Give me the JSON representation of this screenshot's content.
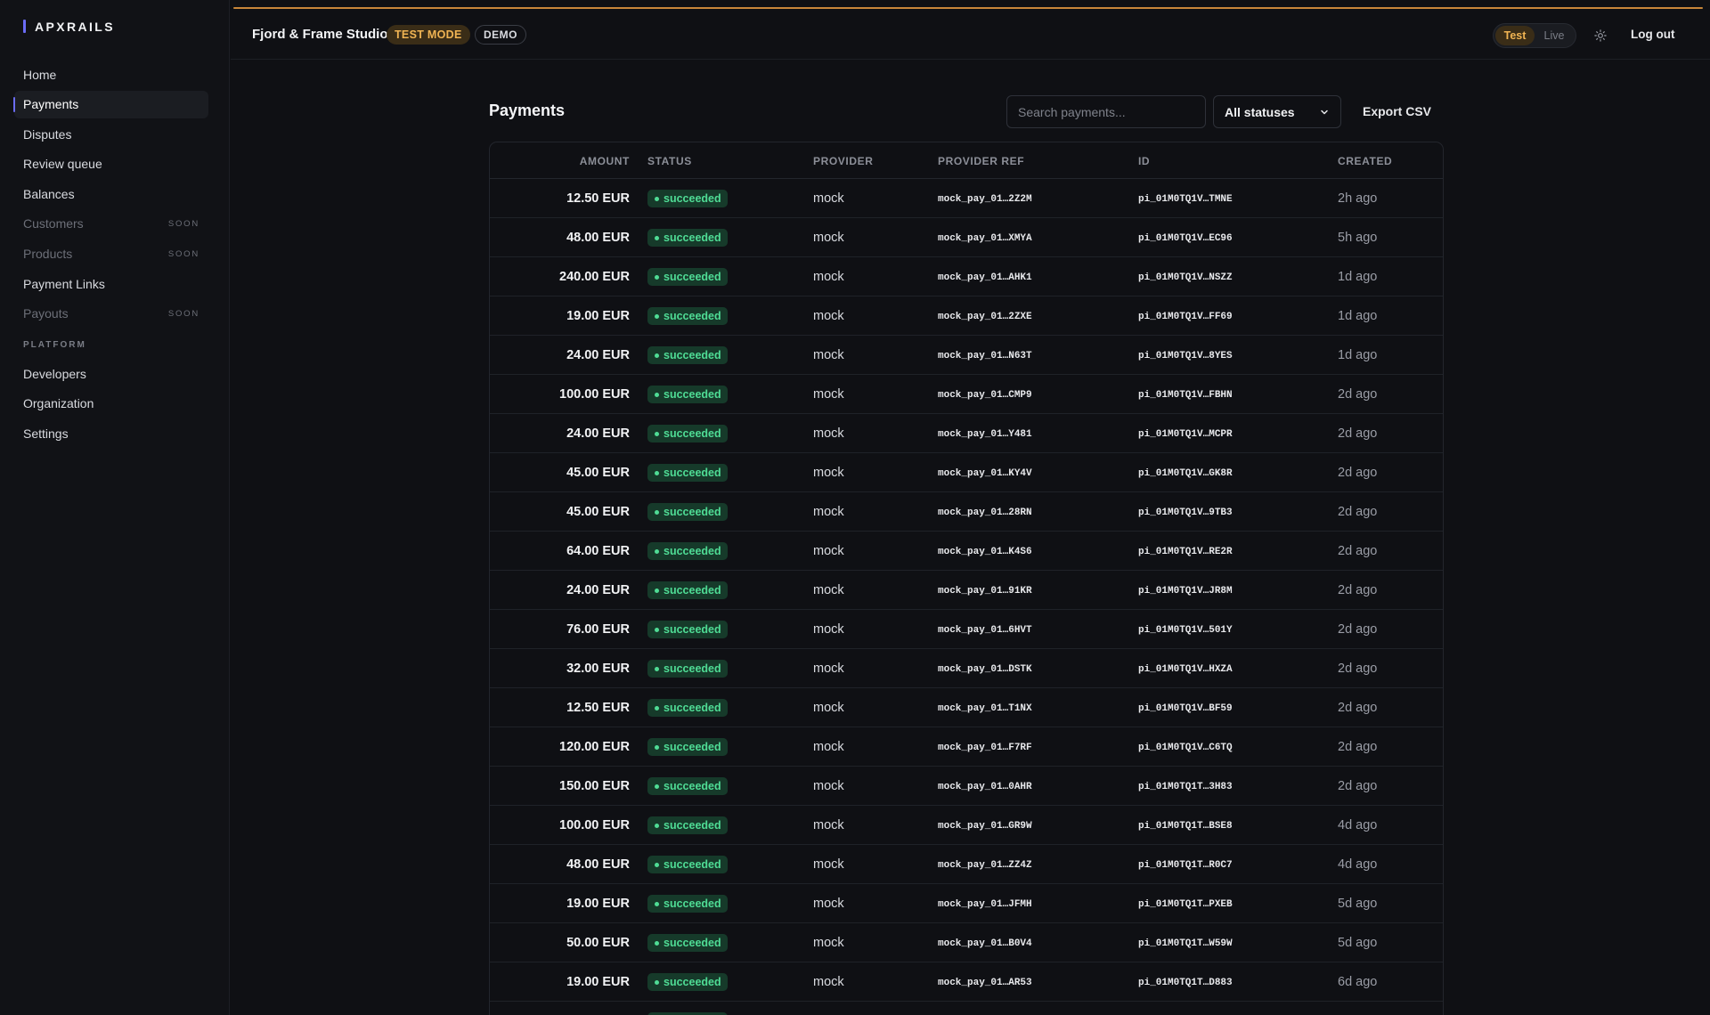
{
  "brand": "APXRAILS",
  "sidebar": {
    "items": [
      {
        "label": "Home",
        "soon": ""
      },
      {
        "label": "Payments",
        "soon": ""
      },
      {
        "label": "Disputes",
        "soon": ""
      },
      {
        "label": "Review queue",
        "soon": ""
      },
      {
        "label": "Balances",
        "soon": ""
      },
      {
        "label": "Customers",
        "soon": "SOON"
      },
      {
        "label": "Products",
        "soon": "SOON"
      },
      {
        "label": "Payment Links",
        "soon": ""
      },
      {
        "label": "Payouts",
        "soon": "SOON"
      }
    ],
    "section_label": "PLATFORM",
    "platform_items": [
      {
        "label": "Developers"
      },
      {
        "label": "Organization"
      },
      {
        "label": "Settings"
      }
    ]
  },
  "header": {
    "org_name": "Fjord & Frame Studio",
    "test_mode_badge": "TEST MODE",
    "demo_badge": "DEMO",
    "mode_test": "Test",
    "mode_live": "Live",
    "logout": "Log out"
  },
  "main": {
    "title": "Payments",
    "search_placeholder": "Search payments...",
    "status_filter": "All statuses",
    "export_label": "Export CSV",
    "columns": {
      "amount": "AMOUNT",
      "status": "STATUS",
      "provider": "PROVIDER",
      "provider_ref": "PROVIDER REF",
      "id": "ID",
      "created": "CREATED"
    },
    "rows": [
      {
        "amount": "12.50 EUR",
        "status": "succeeded",
        "provider": "mock",
        "ref": "mock_pay_01…2Z2M",
        "id": "pi_01M0TQ1V…TMNE",
        "created": "2h ago"
      },
      {
        "amount": "48.00 EUR",
        "status": "succeeded",
        "provider": "mock",
        "ref": "mock_pay_01…XMYA",
        "id": "pi_01M0TQ1V…EC96",
        "created": "5h ago"
      },
      {
        "amount": "240.00 EUR",
        "status": "succeeded",
        "provider": "mock",
        "ref": "mock_pay_01…AHK1",
        "id": "pi_01M0TQ1V…NSZZ",
        "created": "1d ago"
      },
      {
        "amount": "19.00 EUR",
        "status": "succeeded",
        "provider": "mock",
        "ref": "mock_pay_01…2ZXE",
        "id": "pi_01M0TQ1V…FF69",
        "created": "1d ago"
      },
      {
        "amount": "24.00 EUR",
        "status": "succeeded",
        "provider": "mock",
        "ref": "mock_pay_01…N63T",
        "id": "pi_01M0TQ1V…8YES",
        "created": "1d ago"
      },
      {
        "amount": "100.00 EUR",
        "status": "succeeded",
        "provider": "mock",
        "ref": "mock_pay_01…CMP9",
        "id": "pi_01M0TQ1V…FBHN",
        "created": "2d ago"
      },
      {
        "amount": "24.00 EUR",
        "status": "succeeded",
        "provider": "mock",
        "ref": "mock_pay_01…Y481",
        "id": "pi_01M0TQ1V…MCPR",
        "created": "2d ago"
      },
      {
        "amount": "45.00 EUR",
        "status": "succeeded",
        "provider": "mock",
        "ref": "mock_pay_01…KY4V",
        "id": "pi_01M0TQ1V…GK8R",
        "created": "2d ago"
      },
      {
        "amount": "45.00 EUR",
        "status": "succeeded",
        "provider": "mock",
        "ref": "mock_pay_01…28RN",
        "id": "pi_01M0TQ1V…9TB3",
        "created": "2d ago"
      },
      {
        "amount": "64.00 EUR",
        "status": "succeeded",
        "provider": "mock",
        "ref": "mock_pay_01…K4S6",
        "id": "pi_01M0TQ1V…RE2R",
        "created": "2d ago"
      },
      {
        "amount": "24.00 EUR",
        "status": "succeeded",
        "provider": "mock",
        "ref": "mock_pay_01…91KR",
        "id": "pi_01M0TQ1V…JR8M",
        "created": "2d ago"
      },
      {
        "amount": "76.00 EUR",
        "status": "succeeded",
        "provider": "mock",
        "ref": "mock_pay_01…6HVT",
        "id": "pi_01M0TQ1V…501Y",
        "created": "2d ago"
      },
      {
        "amount": "32.00 EUR",
        "status": "succeeded",
        "provider": "mock",
        "ref": "mock_pay_01…DSTK",
        "id": "pi_01M0TQ1V…HXZA",
        "created": "2d ago"
      },
      {
        "amount": "12.50 EUR",
        "status": "succeeded",
        "provider": "mock",
        "ref": "mock_pay_01…T1NX",
        "id": "pi_01M0TQ1V…BF59",
        "created": "2d ago"
      },
      {
        "amount": "120.00 EUR",
        "status": "succeeded",
        "provider": "mock",
        "ref": "mock_pay_01…F7RF",
        "id": "pi_01M0TQ1V…C6TQ",
        "created": "2d ago"
      },
      {
        "amount": "150.00 EUR",
        "status": "succeeded",
        "provider": "mock",
        "ref": "mock_pay_01…0AHR",
        "id": "pi_01M0TQ1T…3H83",
        "created": "2d ago"
      },
      {
        "amount": "100.00 EUR",
        "status": "succeeded",
        "provider": "mock",
        "ref": "mock_pay_01…GR9W",
        "id": "pi_01M0TQ1T…BSE8",
        "created": "4d ago"
      },
      {
        "amount": "48.00 EUR",
        "status": "succeeded",
        "provider": "mock",
        "ref": "mock_pay_01…ZZ4Z",
        "id": "pi_01M0TQ1T…R0C7",
        "created": "4d ago"
      },
      {
        "amount": "19.00 EUR",
        "status": "succeeded",
        "provider": "mock",
        "ref": "mock_pay_01…JFMH",
        "id": "pi_01M0TQ1T…PXEB",
        "created": "5d ago"
      },
      {
        "amount": "50.00 EUR",
        "status": "succeeded",
        "provider": "mock",
        "ref": "mock_pay_01…B0V4",
        "id": "pi_01M0TQ1T…W59W",
        "created": "5d ago"
      },
      {
        "amount": "19.00 EUR",
        "status": "succeeded",
        "provider": "mock",
        "ref": "mock_pay_01…AR53",
        "id": "pi_01M0TQ1T…D883",
        "created": "6d ago"
      },
      {
        "amount": "",
        "status": "succeeded",
        "provider": "",
        "ref": "",
        "id": "",
        "created": ""
      }
    ]
  },
  "colors": {
    "background": "#0f1014",
    "sidebar": "#111216",
    "accent": "#6b6cf6",
    "test_badge": "#f0b453",
    "success": "#4fdc95"
  },
  "icons": {
    "theme_toggle": "sun-icon",
    "status_dropdown": "chevron-down-icon",
    "status_dot": "dot-icon"
  }
}
